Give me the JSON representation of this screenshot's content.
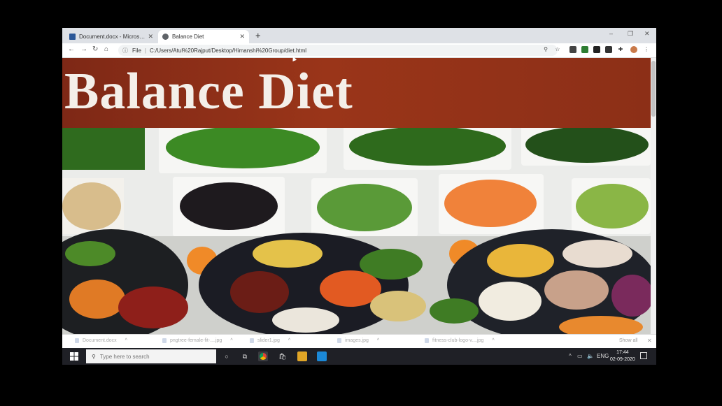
{
  "browser": {
    "tabs": [
      {
        "label": "Document.docx - Microsoft Wor",
        "active": false,
        "icon": "word-icon"
      },
      {
        "label": "Balance Diet",
        "active": true,
        "icon": "globe-icon"
      }
    ],
    "new_tab": "+",
    "window_controls": [
      "–",
      "❐",
      "✕"
    ],
    "address": {
      "security": "File",
      "separator": "|",
      "url": "C:/Users/Atul%20Rajput/Desktop/Himanshi%20Group/diet.html"
    }
  },
  "page": {
    "heading": "Balance Diet",
    "banner_color": "#8c2f17",
    "photo": "food-platter-image"
  },
  "downloads": {
    "items": [
      "Document.docx",
      "pngtree-female-fit-....jpg",
      "slider1.jpg",
      "images.jpg",
      "fitness-club-logo-v....jpg"
    ],
    "show_all": "Show all",
    "close": "✕"
  },
  "taskbar": {
    "search_placeholder": "Type here to search",
    "lang": "ENG",
    "time": "17:44",
    "date": "02-09-2020"
  }
}
